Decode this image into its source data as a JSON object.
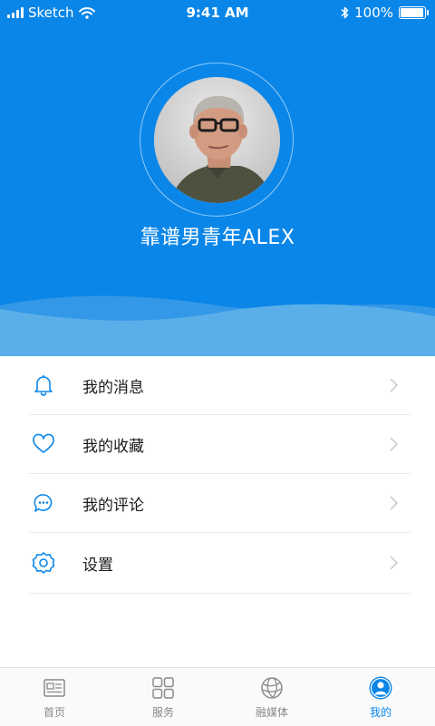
{
  "status_bar": {
    "carrier": "Sketch",
    "time": "9:41 AM",
    "battery": "100%"
  },
  "profile": {
    "username": "靠谱男青年ALEX"
  },
  "menu": {
    "items": [
      {
        "label": "我的消息",
        "icon": "bell-icon"
      },
      {
        "label": "我的收藏",
        "icon": "heart-icon"
      },
      {
        "label": "我的评论",
        "icon": "comment-icon"
      },
      {
        "label": "设置",
        "icon": "gear-icon"
      }
    ]
  },
  "tabbar": {
    "tabs": [
      {
        "label": "首页",
        "icon": "newspaper-icon",
        "active": false
      },
      {
        "label": "服务",
        "icon": "grid-icon",
        "active": false
      },
      {
        "label": "融媒体",
        "icon": "globe-icon",
        "active": false
      },
      {
        "label": "我的",
        "icon": "user-icon",
        "active": true
      }
    ]
  },
  "colors": {
    "primary": "#0a86e8",
    "wave_light": "#5aafe9",
    "text_dark": "#1a1a1a",
    "tab_inactive": "#8a8a8a"
  }
}
